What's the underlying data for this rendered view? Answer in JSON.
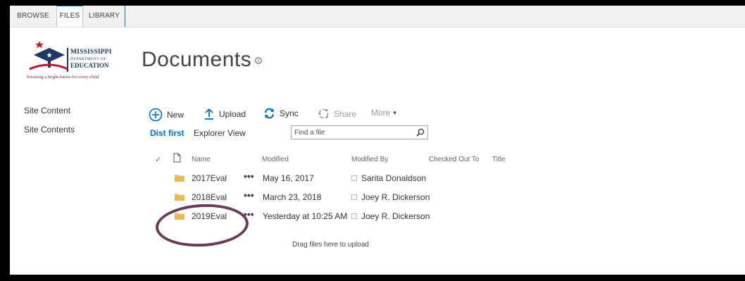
{
  "ribbon": {
    "tabs": [
      "BROWSE",
      "FILES",
      "LIBRARY"
    ]
  },
  "logo": {
    "line1": "MISSISSIPPI",
    "line2": "DEPARTMENT OF",
    "line3": "EDUCATION",
    "tagline": "Ensuring a bright future for every child"
  },
  "page": {
    "title": "Documents"
  },
  "nav": {
    "items": [
      "Site Content",
      "Site Contents"
    ]
  },
  "commands": {
    "new": "New",
    "upload": "Upload",
    "sync": "Sync",
    "share": "Share",
    "more": "More"
  },
  "views": {
    "default": "Dist first",
    "explorer": "Explorer View"
  },
  "search": {
    "placeholder": "Find a file"
  },
  "table": {
    "columns": [
      "Name",
      "Modified",
      "Modified By",
      "Checked Out To",
      "Title"
    ],
    "rows": [
      {
        "name": "2017Eval",
        "modified": "May 16, 2017",
        "modified_by": "Sarita Donaldson"
      },
      {
        "name": "2018Eval",
        "modified": "March 23, 2018",
        "modified_by": "Joey R. Dickerson"
      },
      {
        "name": "2019Eval",
        "modified": "Yesterday at 10:25 AM",
        "modified_by": "Joey R. Dickerson"
      }
    ]
  },
  "drop_hint": "Drag files here to upload",
  "icons": {
    "ellipsis": "•••",
    "check": "✓",
    "chevron": "▾",
    "info": "info-icon"
  },
  "colors": {
    "accent": "#0072c6",
    "folder": "#f0c674",
    "annotation": "#6b3a58"
  }
}
